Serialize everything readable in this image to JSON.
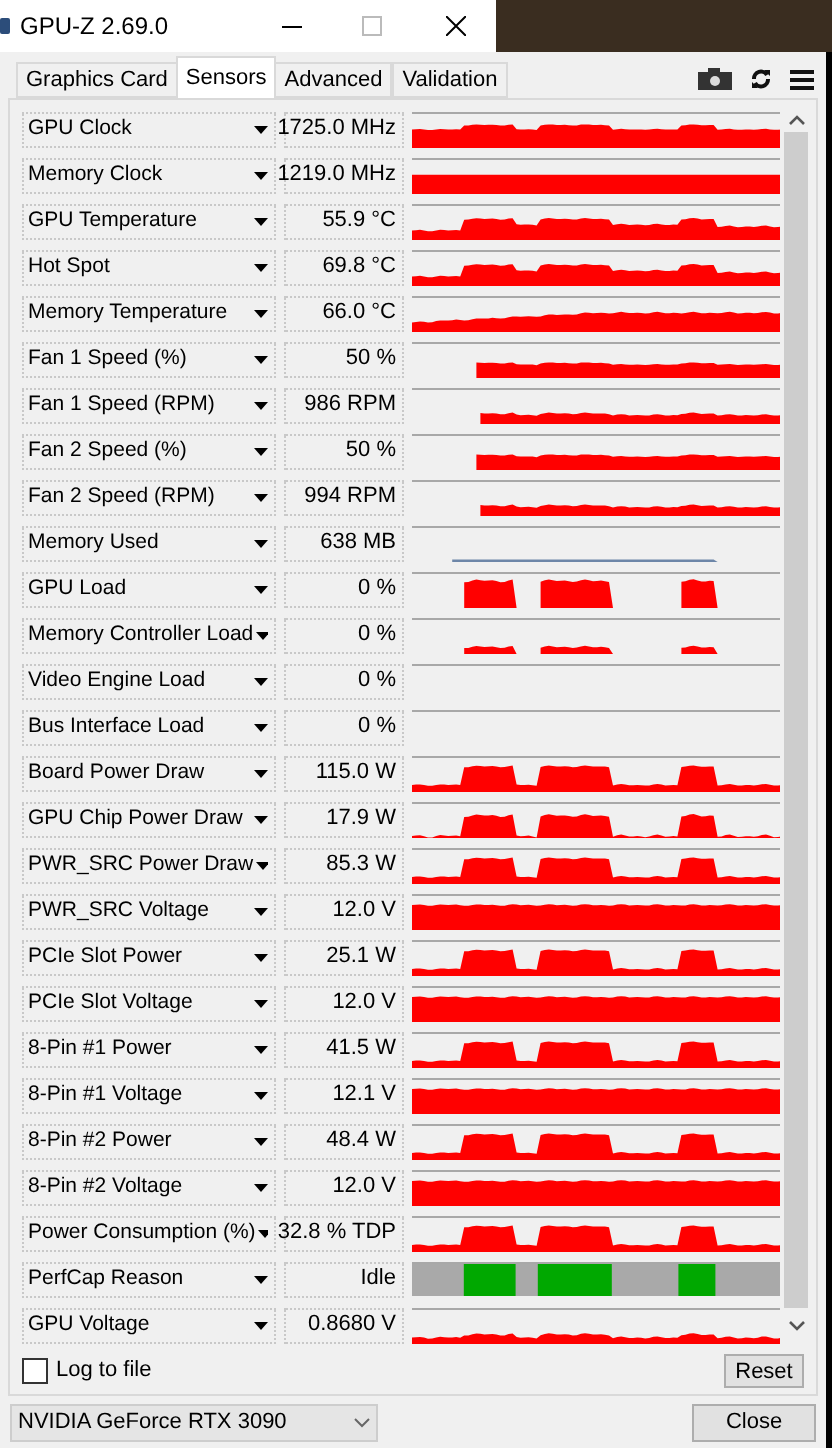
{
  "window": {
    "title": "GPU-Z 2.69.0"
  },
  "tabs": [
    {
      "label": "Graphics Card",
      "selected": false
    },
    {
      "label": "Sensors",
      "selected": true
    },
    {
      "label": "Advanced",
      "selected": false
    },
    {
      "label": "Validation",
      "selected": false
    }
  ],
  "sensors": [
    {
      "label": "GPU Clock",
      "value": "1725.0 MHz",
      "kind": "clock"
    },
    {
      "label": "Memory Clock",
      "value": "1219.0 MHz",
      "kind": "steady"
    },
    {
      "label": "GPU Temperature",
      "value": "55.9 °C",
      "kind": "temperature"
    },
    {
      "label": "Hot Spot",
      "value": "69.8 °C",
      "kind": "temperature"
    },
    {
      "label": "Memory Temperature",
      "value": "66.0 °C",
      "kind": "ramp"
    },
    {
      "label": "Fan 1 Speed (%)",
      "value": "50 %",
      "kind": "fan"
    },
    {
      "label": "Fan 1 Speed (RPM)",
      "value": "986 RPM",
      "kind": "fanrpm"
    },
    {
      "label": "Fan 2 Speed (%)",
      "value": "50 %",
      "kind": "fan"
    },
    {
      "label": "Fan 2 Speed (RPM)",
      "value": "994 RPM",
      "kind": "fanrpm"
    },
    {
      "label": "Memory Used",
      "value": "638 MB",
      "kind": "memory"
    },
    {
      "label": "GPU Load",
      "value": "0 %",
      "kind": "load"
    },
    {
      "label": "Memory Controller Load",
      "value": "0 %",
      "kind": "lowload"
    },
    {
      "label": "Video Engine Load",
      "value": "0 %",
      "kind": "idle"
    },
    {
      "label": "Bus Interface Load",
      "value": "0 %",
      "kind": "idle"
    },
    {
      "label": "Board Power Draw",
      "value": "115.0 W",
      "kind": "power"
    },
    {
      "label": "GPU Chip Power Draw",
      "value": "17.9 W",
      "kind": "chip"
    },
    {
      "label": "PWR_SRC Power Draw",
      "value": "85.3 W",
      "kind": "power"
    },
    {
      "label": "PWR_SRC Voltage",
      "value": "12.0 V",
      "kind": "rail"
    },
    {
      "label": "PCIe Slot Power",
      "value": "25.1 W",
      "kind": "power"
    },
    {
      "label": "PCIe Slot Voltage",
      "value": "12.0 V",
      "kind": "rail"
    },
    {
      "label": "8-Pin #1 Power",
      "value": "41.5 W",
      "kind": "power"
    },
    {
      "label": "8-Pin #1 Voltage",
      "value": "12.1 V",
      "kind": "rail"
    },
    {
      "label": "8-Pin #2 Power",
      "value": "48.4 W",
      "kind": "power"
    },
    {
      "label": "8-Pin #2 Voltage",
      "value": "12.0 V",
      "kind": "rail"
    },
    {
      "label": "Power Consumption (%)",
      "value": "32.8 % TDP",
      "kind": "power"
    },
    {
      "label": "PerfCap Reason",
      "value": "Idle",
      "kind": "perfcap"
    },
    {
      "label": "GPU Voltage",
      "value": "0.8680 V",
      "kind": "voltage"
    }
  ],
  "log_to_file": {
    "label": "Log to file",
    "checked": false
  },
  "reset_button": "Reset",
  "gpu_select": {
    "value": "NVIDIA GeForce RTX 3090"
  },
  "close_button": "Close"
}
